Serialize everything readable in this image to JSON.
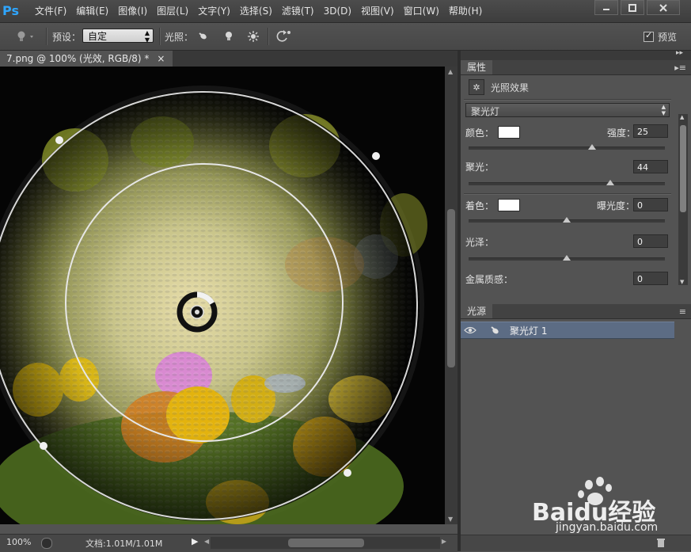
{
  "app": {
    "logo": "Ps",
    "menu": [
      "文件(F)",
      "编辑(E)",
      "图像(I)",
      "图层(L)",
      "文字(Y)",
      "选择(S)",
      "滤镜(T)",
      "3D(D)",
      "视图(V)",
      "窗口(W)",
      "帮助(H)"
    ],
    "window_controls": [
      "minimize-icon",
      "maximize-icon",
      "close-icon"
    ]
  },
  "options_bar": {
    "tool_icon": "light-bulb-icon",
    "preset_label": "预设：",
    "preset_value": "自定",
    "lights_label": "光照：",
    "light_types": [
      "spot-light-icon",
      "point-light-icon",
      "infinite-light-icon"
    ],
    "reset_icon": "rotate-reset-icon",
    "preview_label": "预览",
    "preview_checked": true
  },
  "document": {
    "tab_title": "7.png @ 100% (光效, RGB/8) *",
    "close_glyph": "×",
    "zoom": "100%",
    "doc_info": "文档:1.01M/1.01M"
  },
  "properties": {
    "tab": "属性",
    "header_title": "光照效果",
    "light_type": "聚光灯",
    "color_label": "颜色：",
    "color_value": "#ffffff",
    "intensity_label": "强度：",
    "intensity_value": "25",
    "hotspot_label": "聚光：",
    "hotspot_value": "44",
    "colorize_label": "着色：",
    "colorize_value": "#ffffff",
    "exposure_label": "曝光度：",
    "exposure_value": "0",
    "gloss_label": "光泽：",
    "gloss_value": "0",
    "metallic_label": "金属质感：",
    "metallic_value": "0",
    "slider_positions": {
      "intensity": 0.63,
      "hotspot": 0.72,
      "colorize": 0.5,
      "gloss": 0.5
    }
  },
  "lights": {
    "tab": "光源",
    "items": [
      {
        "name": "聚光灯 1",
        "visible": true
      }
    ],
    "footer_icon": "trash-icon"
  },
  "watermark": {
    "brand": "Baidu经验",
    "url": "jingyan.baidu.com"
  }
}
